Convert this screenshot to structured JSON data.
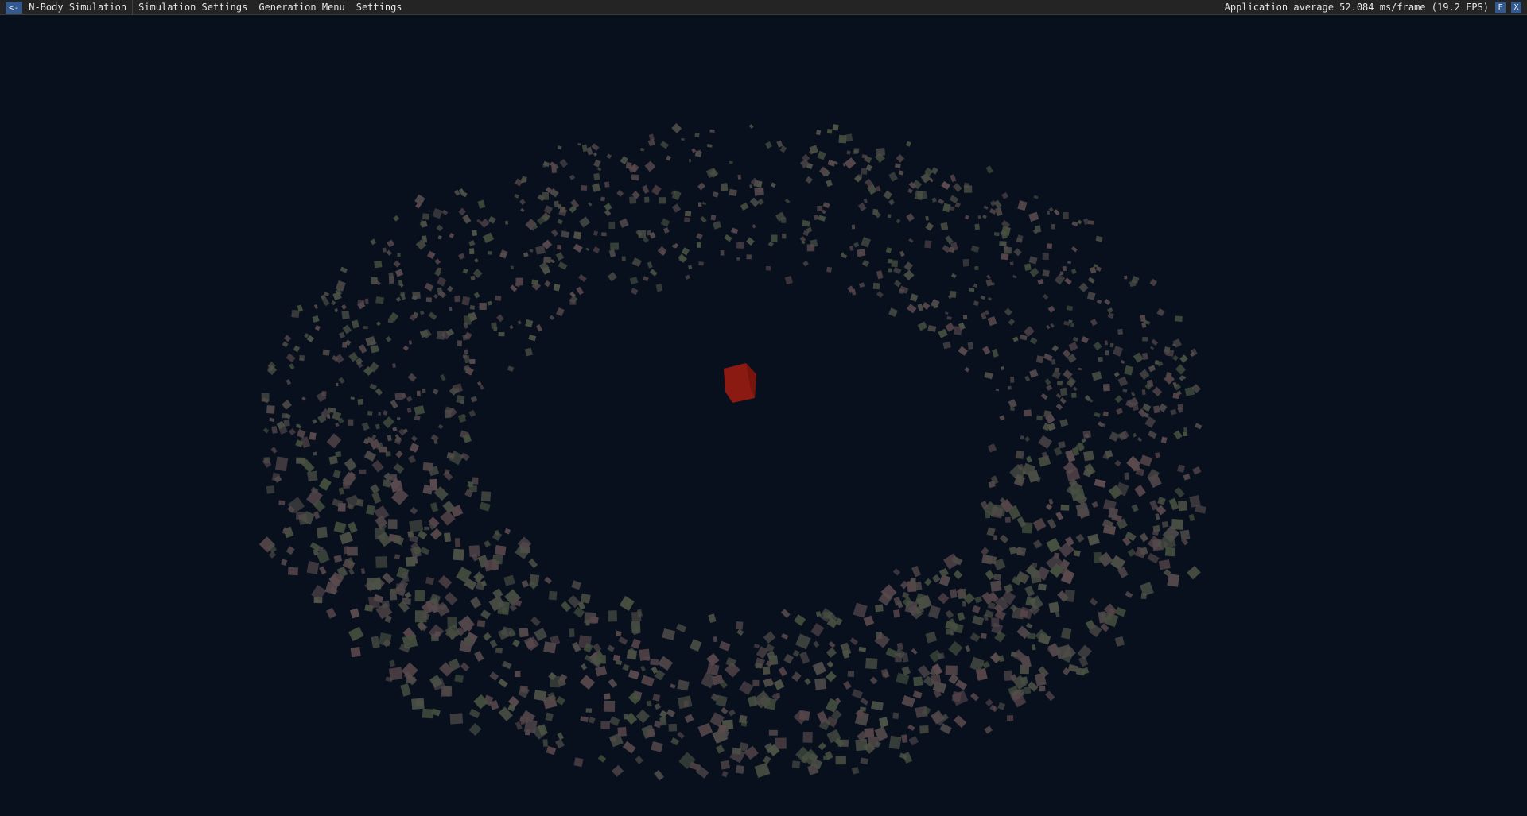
{
  "menubar": {
    "back_label": "<-",
    "title": "N-Body Simulation",
    "items": [
      {
        "label": "Simulation Settings"
      },
      {
        "label": "Generation Menu"
      },
      {
        "label": "Settings"
      }
    ],
    "fps_text": "Application average 52.084 ms/frame (19.2 FPS)",
    "fullscreen_label": "F",
    "close_label": "X"
  },
  "scene": {
    "background_color": "#08101e",
    "central_body_color": "#8b1a12",
    "particle_colors": [
      "#4e4a48",
      "#4d5246",
      "#554549",
      "#4a4e44",
      "#5a4a4e",
      "#46503f",
      "#51474a"
    ]
  }
}
